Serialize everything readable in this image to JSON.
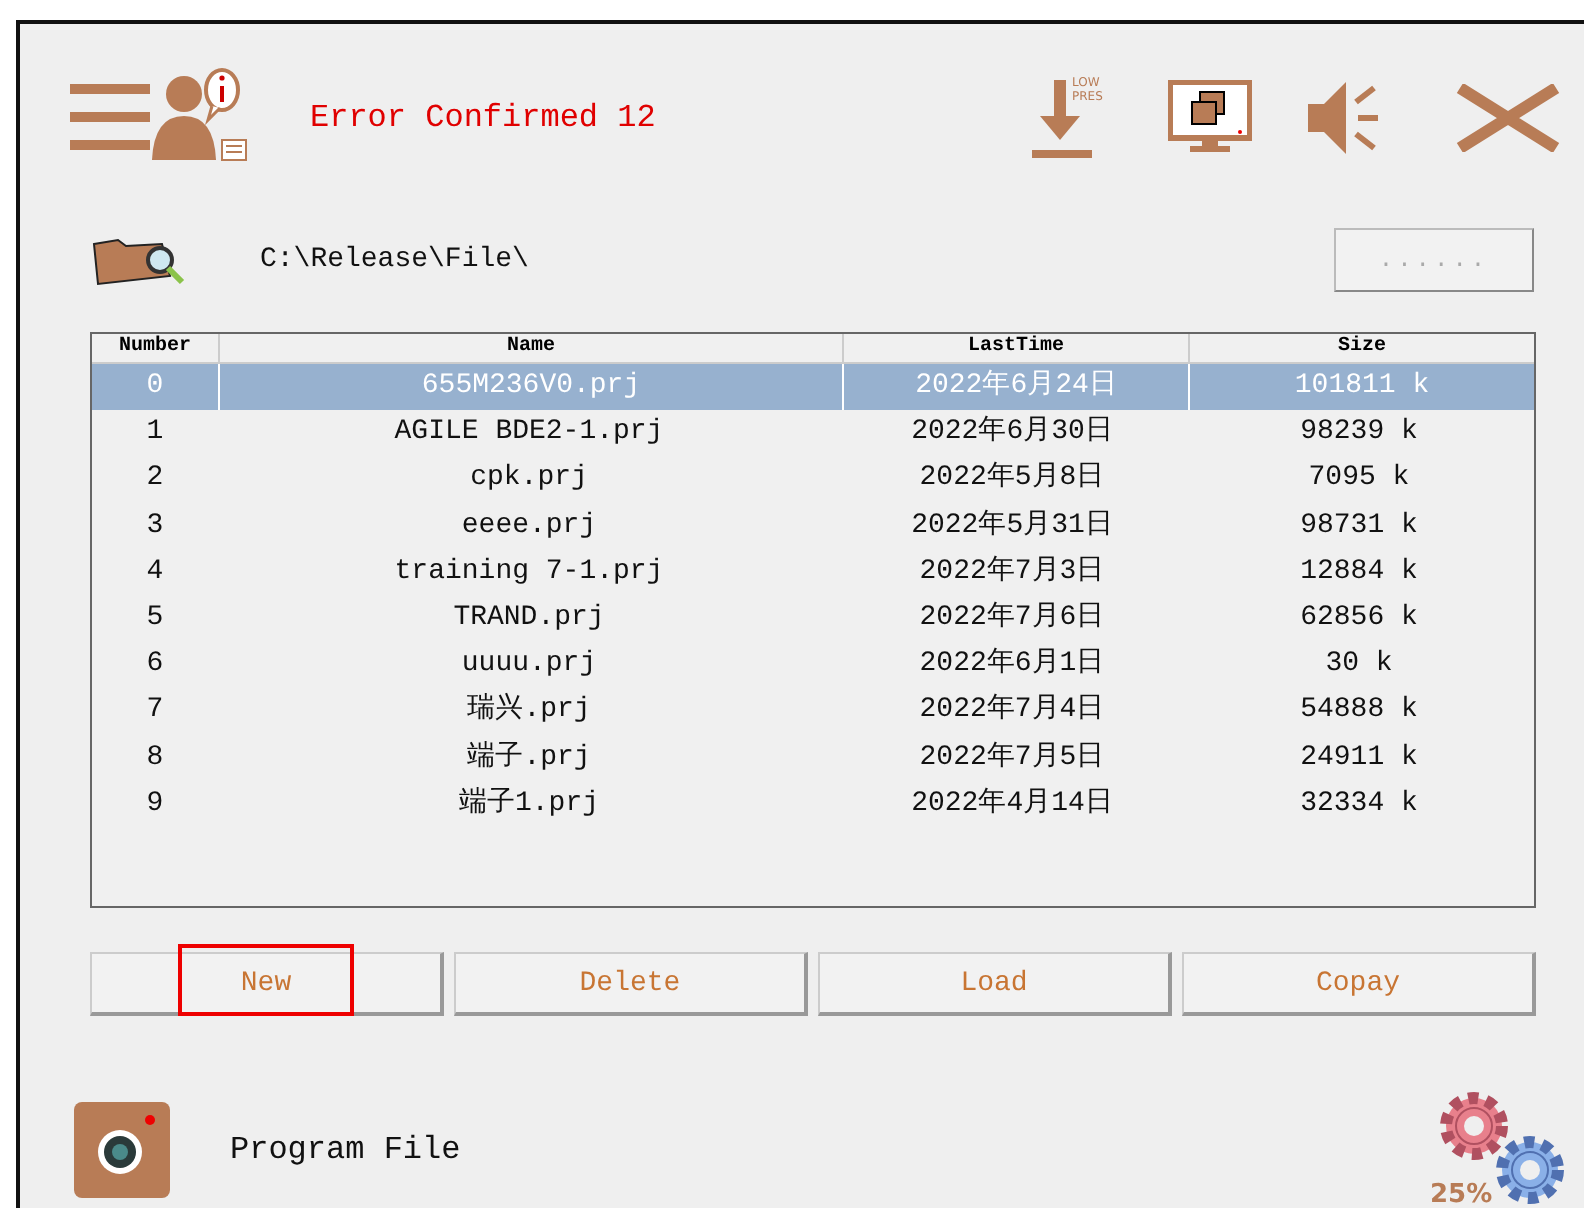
{
  "header": {
    "status_message": "Error Confirmed 12",
    "low_pressure_label_1": "LOW",
    "low_pressure_label_2": "PRES"
  },
  "path_bar": {
    "path": "C:\\Release\\File\\",
    "browse_button": "......"
  },
  "table": {
    "columns": [
      "Number",
      "Name",
      "LastTime",
      "Size"
    ],
    "rows": [
      {
        "cells": [
          "0",
          "655M236V0.prj",
          "2022年6月24日",
          "101811  k"
        ],
        "selected": true
      },
      {
        "cells": [
          "1",
          "AGILE BDE2-1.prj",
          "2022年6月30日",
          "98239  k"
        ],
        "selected": false
      },
      {
        "cells": [
          "2",
          "cpk.prj",
          "2022年5月8日",
          "7095  k"
        ],
        "selected": false
      },
      {
        "cells": [
          "3",
          "eeee.prj",
          "2022年5月31日",
          "98731  k"
        ],
        "selected": false
      },
      {
        "cells": [
          "4",
          "training 7-1.prj",
          "2022年7月3日",
          "12884  k"
        ],
        "selected": false
      },
      {
        "cells": [
          "5",
          "TRAND.prj",
          "2022年7月6日",
          "62856  k"
        ],
        "selected": false
      },
      {
        "cells": [
          "6",
          "uuuu.prj",
          "2022年6月1日",
          "30  k"
        ],
        "selected": false
      },
      {
        "cells": [
          "7",
          "瑞兴.prj",
          "2022年7月4日",
          "54888  k"
        ],
        "selected": false
      },
      {
        "cells": [
          "8",
          "端子.prj",
          "2022年7月5日",
          "24911  k"
        ],
        "selected": false
      },
      {
        "cells": [
          "9",
          "端子1.prj",
          "2022年4月14日",
          "32334  k"
        ],
        "selected": false
      }
    ]
  },
  "buttons": [
    {
      "label": "New",
      "highlighted": true
    },
    {
      "label": "Delete",
      "highlighted": false
    },
    {
      "label": "Load",
      "highlighted": false
    },
    {
      "label": "Copay",
      "highlighted": false
    }
  ],
  "footer": {
    "title": "Program File",
    "progress": "25%"
  }
}
